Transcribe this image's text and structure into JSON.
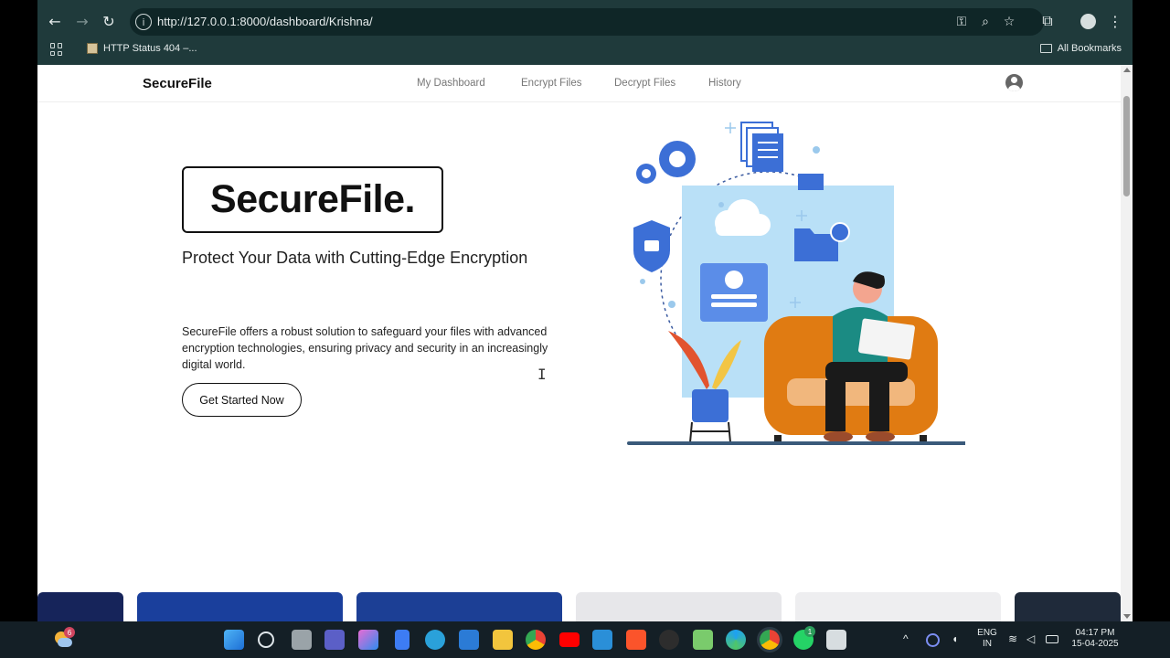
{
  "browser": {
    "url": "http://127.0.0.1:8000/dashboard/Krishna/",
    "bookmark_label": "HTTP Status 404 –...",
    "all_bookmarks_label": "All Bookmarks"
  },
  "site": {
    "brand": "SecureFile",
    "nav": [
      "My Dashboard",
      "Encrypt Files",
      "Decrypt Files",
      "History"
    ],
    "hero_logo": "SecureFile.",
    "subtitle": "Protect Your Data with Cutting-Edge Encryption",
    "description": "SecureFile offers a robust solution to safeguard your files with advanced encryption technologies, ensuring privacy and security in an increasingly digital world.",
    "cta_label": "Get Started Now"
  },
  "taskbar": {
    "weather_badge": "6",
    "whatsapp_badge": "1",
    "language": "ENG",
    "region": "IN",
    "time": "04:17 PM",
    "date": "15-04-2025"
  },
  "colors": {
    "browser_chrome": "#1f3a3b",
    "accent_blue": "#3c6fd6",
    "illustration_panel": "#b9e0f7",
    "armchair": "#e07b12"
  }
}
